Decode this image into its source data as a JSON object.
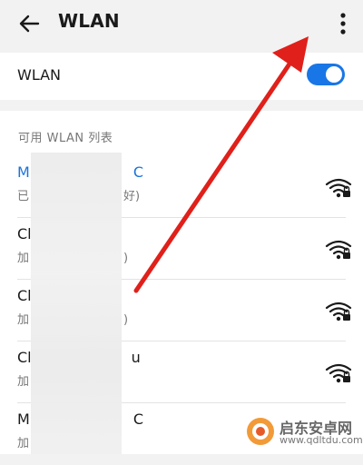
{
  "header": {
    "title": "WLAN",
    "back_icon": "arrow-back-icon",
    "more_icon": "more-vertical-icon"
  },
  "wlan_toggle": {
    "label": "WLAN",
    "state": "on",
    "accent_color": "#1976e6"
  },
  "network_list": {
    "section_title": "可用 WLAN 列表",
    "items": [
      {
        "name": "M",
        "name_tail": "C",
        "status": "已",
        "status_tail": "好)",
        "connected": true,
        "icon": "wifi-lock-icon"
      },
      {
        "name": "Cl",
        "name_tail": "",
        "status": "加",
        "status_tail": ")",
        "connected": false,
        "icon": "wifi-lock-icon"
      },
      {
        "name": "Cl",
        "name_tail": "",
        "status": "加",
        "status_tail": ")",
        "connected": false,
        "icon": "wifi-lock-icon"
      },
      {
        "name": "Cl",
        "name_tail": "u",
        "status": "加",
        "status_tail": "",
        "connected": false,
        "icon": "wifi-lock-icon"
      },
      {
        "name": "M",
        "name_tail": "C",
        "status": "加",
        "status_tail": "",
        "connected": false,
        "icon": "wifi-lock-icon"
      }
    ]
  },
  "watermark": {
    "text": "启东安卓网",
    "url": "www.qdltdu.com"
  }
}
